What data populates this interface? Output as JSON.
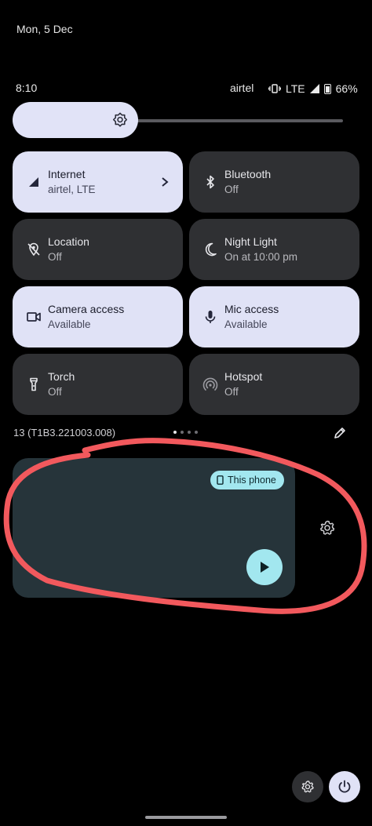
{
  "header": {
    "date": "Mon, 5 Dec"
  },
  "status_bar": {
    "time": "8:10",
    "carrier": "airtel",
    "network": "LTE",
    "battery": "66%"
  },
  "brightness": {
    "level_fraction": 0.38,
    "icon": "brightness-icon"
  },
  "tiles": [
    {
      "label": "Internet",
      "sub": "airtel, LTE",
      "state": "on",
      "icon": "signal-icon"
    },
    {
      "label": "Bluetooth",
      "sub": "Off",
      "state": "off",
      "icon": "bluetooth-icon"
    },
    {
      "label": "Location",
      "sub": "Off",
      "state": "off",
      "icon": "location-off-icon"
    },
    {
      "label": "Night Light",
      "sub": "On at 10:00 pm",
      "state": "off",
      "icon": "moon-icon"
    },
    {
      "label": "Camera access",
      "sub": "Available",
      "state": "on",
      "icon": "camera-icon"
    },
    {
      "label": "Mic access",
      "sub": "Available",
      "state": "on",
      "icon": "mic-icon"
    },
    {
      "label": "Torch",
      "sub": "Off",
      "state": "off",
      "icon": "torch-icon"
    },
    {
      "label": "Hotspot",
      "sub": "Off",
      "state": "off",
      "icon": "hotspot-icon"
    }
  ],
  "footer": {
    "build": "13 (T1B3.221003.008)",
    "page_count": 4,
    "active_page": 0
  },
  "media": {
    "output_chip": "This phone"
  },
  "colors": {
    "accent": "#e0e2f6",
    "tile_off": "#2f3033",
    "media_bg": "#26343a",
    "media_accent": "#a2e7ef",
    "annotation": "#f2595d"
  }
}
